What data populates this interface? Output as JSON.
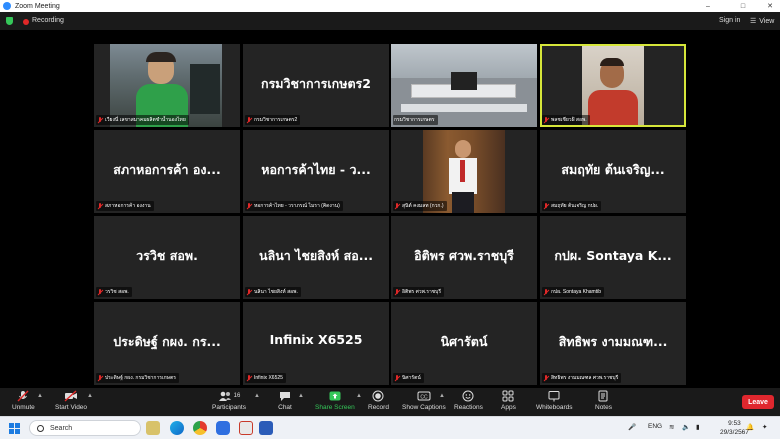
{
  "window": {
    "title": "Zoom Meeting"
  },
  "topbar": {
    "recording_label": "Recording",
    "signin_label": "Sign in",
    "view_label": "View"
  },
  "tiles": [
    {
      "name": "",
      "label": "เวียงนี่ เลขาสมาคมผลิตชำน้ำนองไทย",
      "muted": true,
      "video": "person-car"
    },
    {
      "name": "กรมวิชาการเกษตร2",
      "label": "กรมวิชาการเกษตร2",
      "muted": true
    },
    {
      "name": "",
      "label": "กรมวิชาการเกษตร",
      "muted": false,
      "video": "meeting-room"
    },
    {
      "name": "",
      "label": "พลชเชียวฝ้ สอพ.",
      "muted": true,
      "video": "person-speaking",
      "active": true
    },
    {
      "name": "สภาหอการค้า อง...",
      "label": "สภาหอการค้า องงาน",
      "muted": true
    },
    {
      "name": "หอการค้าไทย - ว...",
      "label": "หอการค้าไทย - วราภรณ์ ไมรา (คิดงาน)",
      "muted": true
    },
    {
      "name": "",
      "label": "สุนิต์ คงมลท (กวก.)",
      "muted": true,
      "video": "person-standing"
    },
    {
      "name": "สมฤทัย ต้นเจริญ...",
      "label": "สมฤทัย ต้นเจริญ กปผ.",
      "muted": true
    },
    {
      "name": "วรวิช สอพ.",
      "label": "วรวิช สอพ.",
      "muted": true
    },
    {
      "name": "นลินา ไชยสิงห์ สอ...",
      "label": "นลินา ไชยสิงห์ สอพ.",
      "muted": true
    },
    {
      "name": "อิติพร ศวพ.ราชบุรี",
      "label": "อิติพร ศวพ.ราชบุรี",
      "muted": true
    },
    {
      "name": "กปผ. Sontaya K...",
      "label": "กปผ. Sontaya Khamtib",
      "muted": true
    },
    {
      "name": "ประดิษฐ์ กผง. กร...",
      "label": "ประดิษฐ์ กผง. กรมวิชาการเกษตร",
      "muted": true
    },
    {
      "name": "Infinix X6525",
      "label": "Infinix X6525",
      "muted": true
    },
    {
      "name": "นิศารัตน์",
      "label": "นิศารัตน์",
      "muted": true
    },
    {
      "name": "สิทธิพร งามมณฑ...",
      "label": "สิทธิพร งามมณฑล ศวพ.ราชบุรี",
      "muted": true
    }
  ],
  "toolbar": {
    "unmute": "Unmute",
    "start_video": "Start Video",
    "participants": "Participants",
    "participants_count": "16",
    "chat": "Chat",
    "share_screen": "Share Screen",
    "record": "Record",
    "show_captions": "Show Captions",
    "reactions": "Reactions",
    "apps": "Apps",
    "whiteboards": "Whiteboards",
    "notes": "Notes",
    "leave": "Leave"
  },
  "taskbar": {
    "search_placeholder": "Search",
    "language": "ENG",
    "time": "9:53",
    "date": "29/3/2567"
  },
  "colors": {
    "accent_green": "#35c759",
    "leave_red": "#e0272e",
    "active_speaker": "#d6e63a",
    "zoom_blue": "#2d8cff"
  }
}
